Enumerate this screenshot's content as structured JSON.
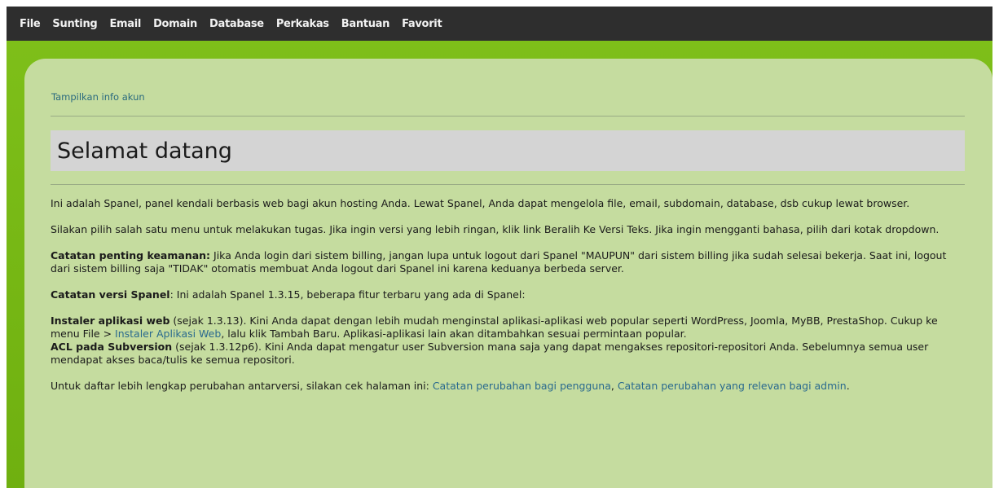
{
  "menubar": {
    "items": [
      "File",
      "Sunting",
      "Email",
      "Domain",
      "Database",
      "Perkakas",
      "Bantuan",
      "Favorit"
    ]
  },
  "panel": {
    "account_link": "Tampilkan info akun",
    "title": "Selamat datang",
    "para1": "Ini adalah Spanel, panel kendali berbasis web bagi akun hosting Anda. Lewat Spanel, Anda dapat mengelola file, email, subdomain, database, dsb cukup lewat browser.",
    "para2": "Silakan pilih salah satu menu untuk melakukan tugas. Jika ingin versi yang lebih ringan, klik link Beralih Ke Versi Teks. Jika ingin mengganti bahasa, pilih dari kotak dropdown.",
    "security_label": "Catatan penting keamanan:",
    "security_text": " Jika Anda login dari sistem billing, jangan lupa untuk logout dari Spanel \"MAUPUN\" dari sistem billing jika sudah selesai bekerja. Saat ini, logout dari sistem billing saja \"TIDAK\" otomatis membuat Anda logout dari Spanel ini karena keduanya berbeda server.",
    "version_label": "Catatan versi Spanel",
    "version_text": ": Ini adalah Spanel 1.3.15, beberapa fitur terbaru yang ada di Spanel:",
    "installer_label": "Instaler aplikasi web",
    "installer_text1": " (sejak 1.3.13). Kini Anda dapat dengan lebih mudah menginstal aplikasi-aplikasi web popular seperti WordPress, Joomla, MyBB, PrestaShop. Cukup ke menu File > ",
    "installer_link": "Instaler Aplikasi Web",
    "installer_text2": ", lalu klik Tambah Baru. Aplikasi-aplikasi lain akan ditambahkan sesuai permintaan popular.",
    "acl_label": "ACL pada Subversion",
    "acl_text": " (sejak 1.3.12p6). Kini Anda dapat mengatur user Subversion mana saja yang dapat mengakses repositori-repositori Anda. Sebelumnya semua user mendapat akses baca/tulis ke semua repositori.",
    "changelog_text": "Untuk daftar lebih lengkap perubahan antarversi, silakan cek halaman ini: ",
    "changelog_link_user": "Catatan perubahan bagi pengguna",
    "changelog_sep": ", ",
    "changelog_link_admin": "Catatan perubahan yang relevan bagi admin",
    "changelog_end": "."
  },
  "colors": {
    "menubar_bg": "#2e2e2e",
    "frame_green": "#7fc01a",
    "panel_bg": "#c5dc9f",
    "title_bg": "#d4d4d4",
    "link": "#2a6a8e"
  }
}
